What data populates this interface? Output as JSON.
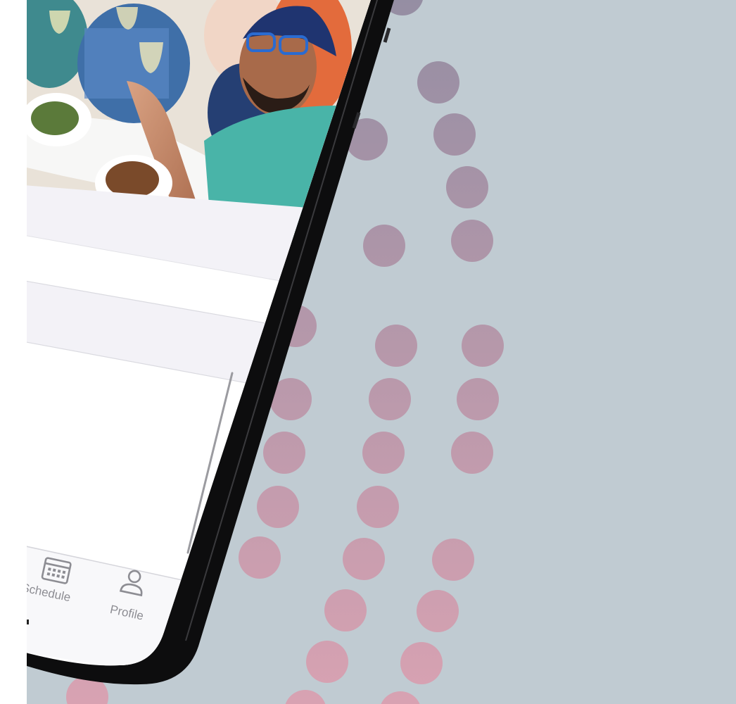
{
  "colors": {
    "background": "#c0cbd2",
    "phone_frame": "#0d0d0e",
    "screen": "#ffffff",
    "section_gray": "#f3f2f7",
    "dot_top": "#958ea3",
    "dot_bottom": "#d8a2b2",
    "tab_icon": "#8d8d93"
  },
  "app": {
    "hero_image": "people-dining-photo",
    "tab_bar": {
      "items": [
        {
          "label": "Schedule",
          "icon": "calendar-icon"
        },
        {
          "label": "Profile",
          "icon": "person-icon"
        }
      ]
    }
  }
}
